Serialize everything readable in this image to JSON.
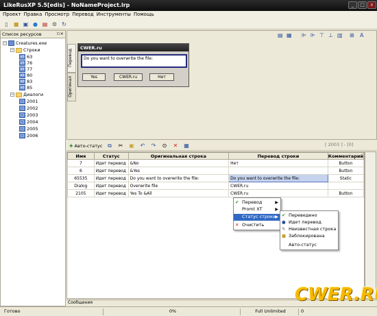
{
  "window": {
    "title": "LikeRusXP 5.5[edis] - NoNameProject.lrp"
  },
  "menubar": [
    "Проект",
    "Правка",
    "Просмотр",
    "Перевод",
    "Инструменты",
    "Помощь"
  ],
  "left_panel": {
    "title": "Список ресурсов",
    "root": "Creatures.exe",
    "strings_folder": "Строки",
    "strings": [
      "63",
      "76",
      "77",
      "80",
      "83",
      "85"
    ],
    "dialogs_folder": "Диалоги",
    "dialogs": [
      "2001",
      "2002",
      "2003",
      "2004",
      "2005",
      "2006"
    ]
  },
  "vertical_tabs": [
    "Перевод",
    "Оригинал"
  ],
  "dialog_preview": {
    "title": "CWER.ru",
    "text": "Do you want to overwrite the file:",
    "buttons": [
      "Yes",
      "CWER.ru",
      "Нет"
    ]
  },
  "grid_toolbar": {
    "auto_status": "Авто-статус",
    "page_indicator": "[ 2003 ] - [0]"
  },
  "grid": {
    "columns": [
      "Имя",
      "Статус",
      "Оригинальная строка",
      "Перевод строки",
      "Комментарий"
    ],
    "rows": [
      {
        "name": "7",
        "status": "Идет перевод",
        "original": "&No",
        "translation": "Нет",
        "comment": "Button"
      },
      {
        "name": "6",
        "status": "Идет перевод",
        "original": "&Yes",
        "translation": "",
        "comment": "Button"
      },
      {
        "name": "65535",
        "status": "Идет перевод",
        "original": "Do you want to overwrite the file:",
        "translation": "Do you want to overwrite the file:",
        "comment": "Static"
      },
      {
        "name": "Dialog",
        "status": "Идет перевод",
        "original": "Overwrite file",
        "translation": "CWER.ru",
        "comment": ""
      },
      {
        "name": "2105",
        "status": "Идет перевод",
        "original": "Yes To &All",
        "translation": "CWER.ru",
        "comment": "Button"
      }
    ]
  },
  "context_menu": {
    "items": [
      "Перевод",
      "Promt XT",
      "Статус строки",
      "Очистить"
    ]
  },
  "status_submenu": {
    "items": [
      "Переведено",
      "Идет перевод",
      "Неизвестная строка",
      "Заблокирована",
      "Авто-статус"
    ]
  },
  "messages_tab": "Сообщения",
  "statusbar": {
    "ready": "Готово",
    "progress": "0%",
    "license": "Full Unlimited",
    "count": "0"
  },
  "watermark": "CWER.RU",
  "colors": {
    "titlebar": "#1a1a1a",
    "selection": "#316ac5",
    "watermark": "#f7b900"
  }
}
